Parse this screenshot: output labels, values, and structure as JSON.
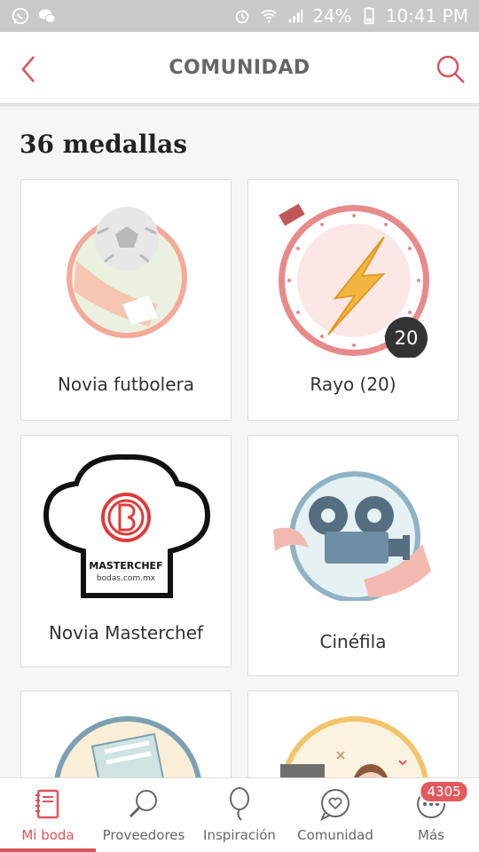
{
  "status": {
    "battery": "24%",
    "time": "10:41 PM"
  },
  "header": {
    "title": "COMUNIDAD"
  },
  "main": {
    "count_title": "36 medallas",
    "medals": [
      {
        "label": "Novia futbolera"
      },
      {
        "label": "Rayo (20)",
        "badge": "20"
      },
      {
        "label": "Novia Masterchef",
        "logo_text": "MASTERCHEF",
        "logo_sub": "bodas.com.mx"
      },
      {
        "label": "Cinéfila"
      }
    ]
  },
  "tabbar": {
    "tabs": [
      {
        "label": "Mi boda",
        "icon": "notebook-icon",
        "active": true
      },
      {
        "label": "Proveedores",
        "icon": "search-icon"
      },
      {
        "label": "Inspiración",
        "icon": "balloon-icon"
      },
      {
        "label": "Comunidad",
        "icon": "chat-heart-icon"
      },
      {
        "label": "Más",
        "icon": "more-icon",
        "badge": "4305"
      }
    ]
  },
  "colors": {
    "accent": "#d9545b",
    "status_bar": "#c9c9c9"
  }
}
